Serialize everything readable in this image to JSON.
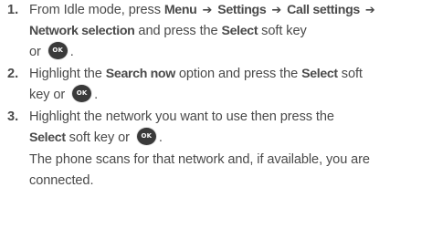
{
  "steps": [
    {
      "number": "1.",
      "t1": "From Idle mode, press ",
      "menu": "Menu",
      "arrow": "➔",
      "settings": "Settings",
      "call_settings": "Call settings",
      "network_selection": "Network selection",
      "t2": " and press the ",
      "select": "Select",
      "t3": " soft key",
      "t4": "or",
      "t5": "."
    },
    {
      "number": "2.",
      "t1": "Highlight the ",
      "search_now": "Search now",
      "t2": " option and press the ",
      "select": "Select",
      "t3": " soft",
      "t4": "key or",
      "t5": "."
    },
    {
      "number": "3.",
      "t1": "Highlight the network you want to use then press the",
      "select": "Select",
      "t2": " soft key or",
      "t3": ".",
      "t4": "The phone scans for that network and, if available, you are",
      "t5": "connected."
    }
  ],
  "ok_icon": {
    "label": "OK",
    "color": "#3a3a3a"
  },
  "text_color": "#4a4a4a"
}
